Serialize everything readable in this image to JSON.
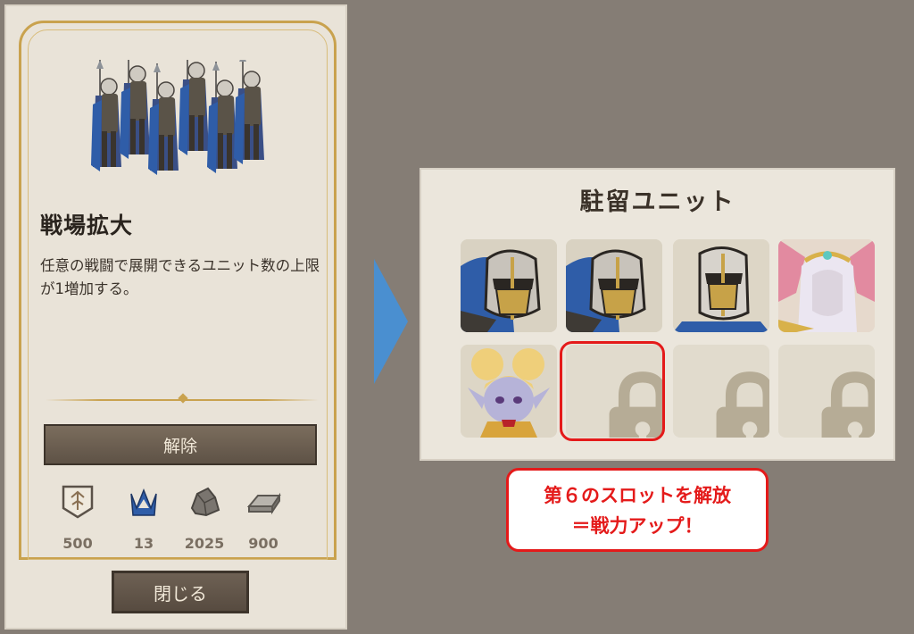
{
  "upgrade_panel": {
    "title": "戦場拡大",
    "description": "任意の戦闘で展開できるユニット数の上限が1増加する。",
    "unlock_label": "解除",
    "close_label": "閉じる",
    "costs": [
      {
        "icon": "emblem-icon",
        "value": "500"
      },
      {
        "icon": "crown-icon",
        "value": "13"
      },
      {
        "icon": "stone-icon",
        "value": "2025"
      },
      {
        "icon": "iron-ingot-icon",
        "value": "900"
      }
    ]
  },
  "garrison_panel": {
    "title": "駐留ユニット",
    "slots": [
      {
        "type": "knight-portrait"
      },
      {
        "type": "knight-portrait"
      },
      {
        "type": "knight-portrait"
      },
      {
        "type": "sorceress-portrait"
      },
      {
        "type": "yordle-portrait"
      },
      {
        "type": "locked"
      },
      {
        "type": "locked"
      },
      {
        "type": "locked"
      }
    ]
  },
  "callout": {
    "line1": "第６のスロットを解放",
    "line2": "＝戦力アップ！"
  },
  "colors": {
    "background": "#857d75",
    "panel": "#e9e3d8",
    "gold": "#c9a24e",
    "button": "#6e6154",
    "highlight_red": "#e41a1a",
    "arrow_blue": "#4a8fd0"
  }
}
